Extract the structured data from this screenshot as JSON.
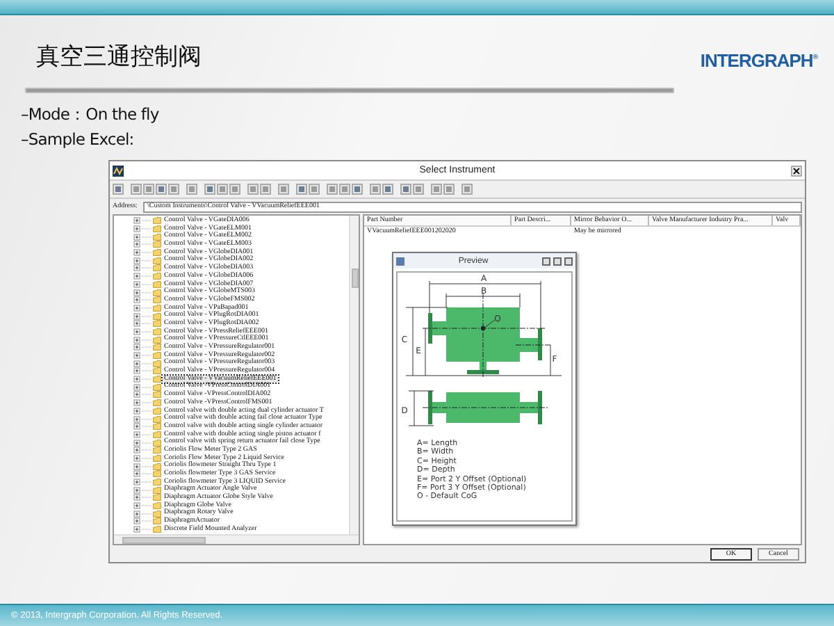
{
  "slide": {
    "title": "真空三通控制阀",
    "logo": "INTERGRAPH$^{®}$",
    "bullets": [
      "–Mode：On the fly",
      "–Sample Excel:"
    ],
    "footer": "© 2013, Intergraph Corporation. All Rights Reserved."
  },
  "dialog": {
    "title": "Select Instrument",
    "address_label": "Address:",
    "address": "\\Custom Instruments\\Control Valve - VVacuumReliefEEE001",
    "tree": [
      {
        "label": "Control Valve - VGateDIA006",
        "selected": false
      },
      {
        "label": "Control Valve - VGateELM001",
        "selected": false
      },
      {
        "label": "Control Valve - VGateELM002",
        "selected": false
      },
      {
        "label": "Control Valve - VGateELM003",
        "selected": false
      },
      {
        "label": "Control Valve - VGlobeDIA001",
        "selected": false
      },
      {
        "label": "Control Valve - VGlobeDIA002",
        "selected": false
      },
      {
        "label": "Control Valve - VGlobeDIA003",
        "selected": false
      },
      {
        "label": "Control Valve - VGlobeDIA006",
        "selected": false
      },
      {
        "label": "Control Valve - VGlobeDIA007",
        "selected": false
      },
      {
        "label": "Control Valve - VGlobeMTS003",
        "selected": false
      },
      {
        "label": "Control Valve - VGlobeFMS002",
        "selected": false
      },
      {
        "label": "Control Valve - VPaBapad001",
        "selected": false
      },
      {
        "label": "Control Valve - VPlugRotDIA001",
        "selected": false
      },
      {
        "label": "Control Valve - VPlugRotDIA002",
        "selected": false
      },
      {
        "label": "Control Valve - VPressReliefEEE001",
        "selected": false
      },
      {
        "label": "Control Valve - VPressureCtlEEE001",
        "selected": false
      },
      {
        "label": "Control Valve - VPressureRegulator001",
        "selected": false
      },
      {
        "label": "Control Valve - VPressureRegulator002",
        "selected": false
      },
      {
        "label": "Control Valve - VPressureRegulator003",
        "selected": false
      },
      {
        "label": "Control Valve - VPressureRegulator004",
        "selected": false
      },
      {
        "label": "Control Valve - VVacuumReliefEEE001",
        "selected": true
      },
      {
        "label": "Control Valve -VPressControlDIA001",
        "selected": false
      },
      {
        "label": "Control Valve -VPressControlDIA002",
        "selected": false
      },
      {
        "label": "Control Valve -VPressControlFMS001",
        "selected": false
      },
      {
        "label": "Control valve with double acting dual cylinder actuator T",
        "selected": false
      },
      {
        "label": "Control valve with double acting fail close actuator Type",
        "selected": false
      },
      {
        "label": "Control valve with double acting single cylinder actuator",
        "selected": false
      },
      {
        "label": "Control valve with double acting single piston actuator f",
        "selected": false
      },
      {
        "label": "Control valve with spring return actuator fail close Type",
        "selected": false
      },
      {
        "label": "Coriolis Flow Meter Type 2 GAS",
        "selected": false
      },
      {
        "label": "Coriolis Flow Meter Type 2 Liquid Service",
        "selected": false
      },
      {
        "label": "Coriolis flowmeter Straight Thru Type 1",
        "selected": false
      },
      {
        "label": "Coriolis flowmeter Type 3 GAS Service",
        "selected": false
      },
      {
        "label": "Coriolis flowmeter Type 3 LIQUID Service",
        "selected": false
      },
      {
        "label": "Diaphragm Actuator Angle Valve",
        "selected": false
      },
      {
        "label": "Diaphragm Actuator Globe Style Valve",
        "selected": false
      },
      {
        "label": "Diaphragm Globe Valve",
        "selected": false
      },
      {
        "label": "Diaphragm Rotary Valve",
        "selected": false
      },
      {
        "label": "DiaphragmActuator",
        "selected": false
      },
      {
        "label": "Discrete Field Mounted Analyzer",
        "selected": false
      }
    ],
    "table": {
      "columns": [
        "Part Number",
        "Part Descri...",
        "Mirror Behavior O...",
        "Valve Manufacturer Industry Pra...",
        "Valv"
      ],
      "rows": [
        {
          "part_number": "VVacuumReliefEEE001202020",
          "mirror_behavior": "May be mirrored"
        }
      ]
    },
    "preview": {
      "title": "Preview",
      "dimension_labels": [
        "A",
        "B",
        "O",
        "C",
        "E",
        "F",
        "D"
      ],
      "legend": [
        "A= Length",
        "B= Width",
        "C= Height",
        "D= Depth",
        "E= Port 2 Y Offset (Optional)",
        "F= Port 3 Y Offset (Optional)",
        "O - Default CoG"
      ]
    },
    "buttons": [
      "OK",
      "Cancel"
    ]
  }
}
